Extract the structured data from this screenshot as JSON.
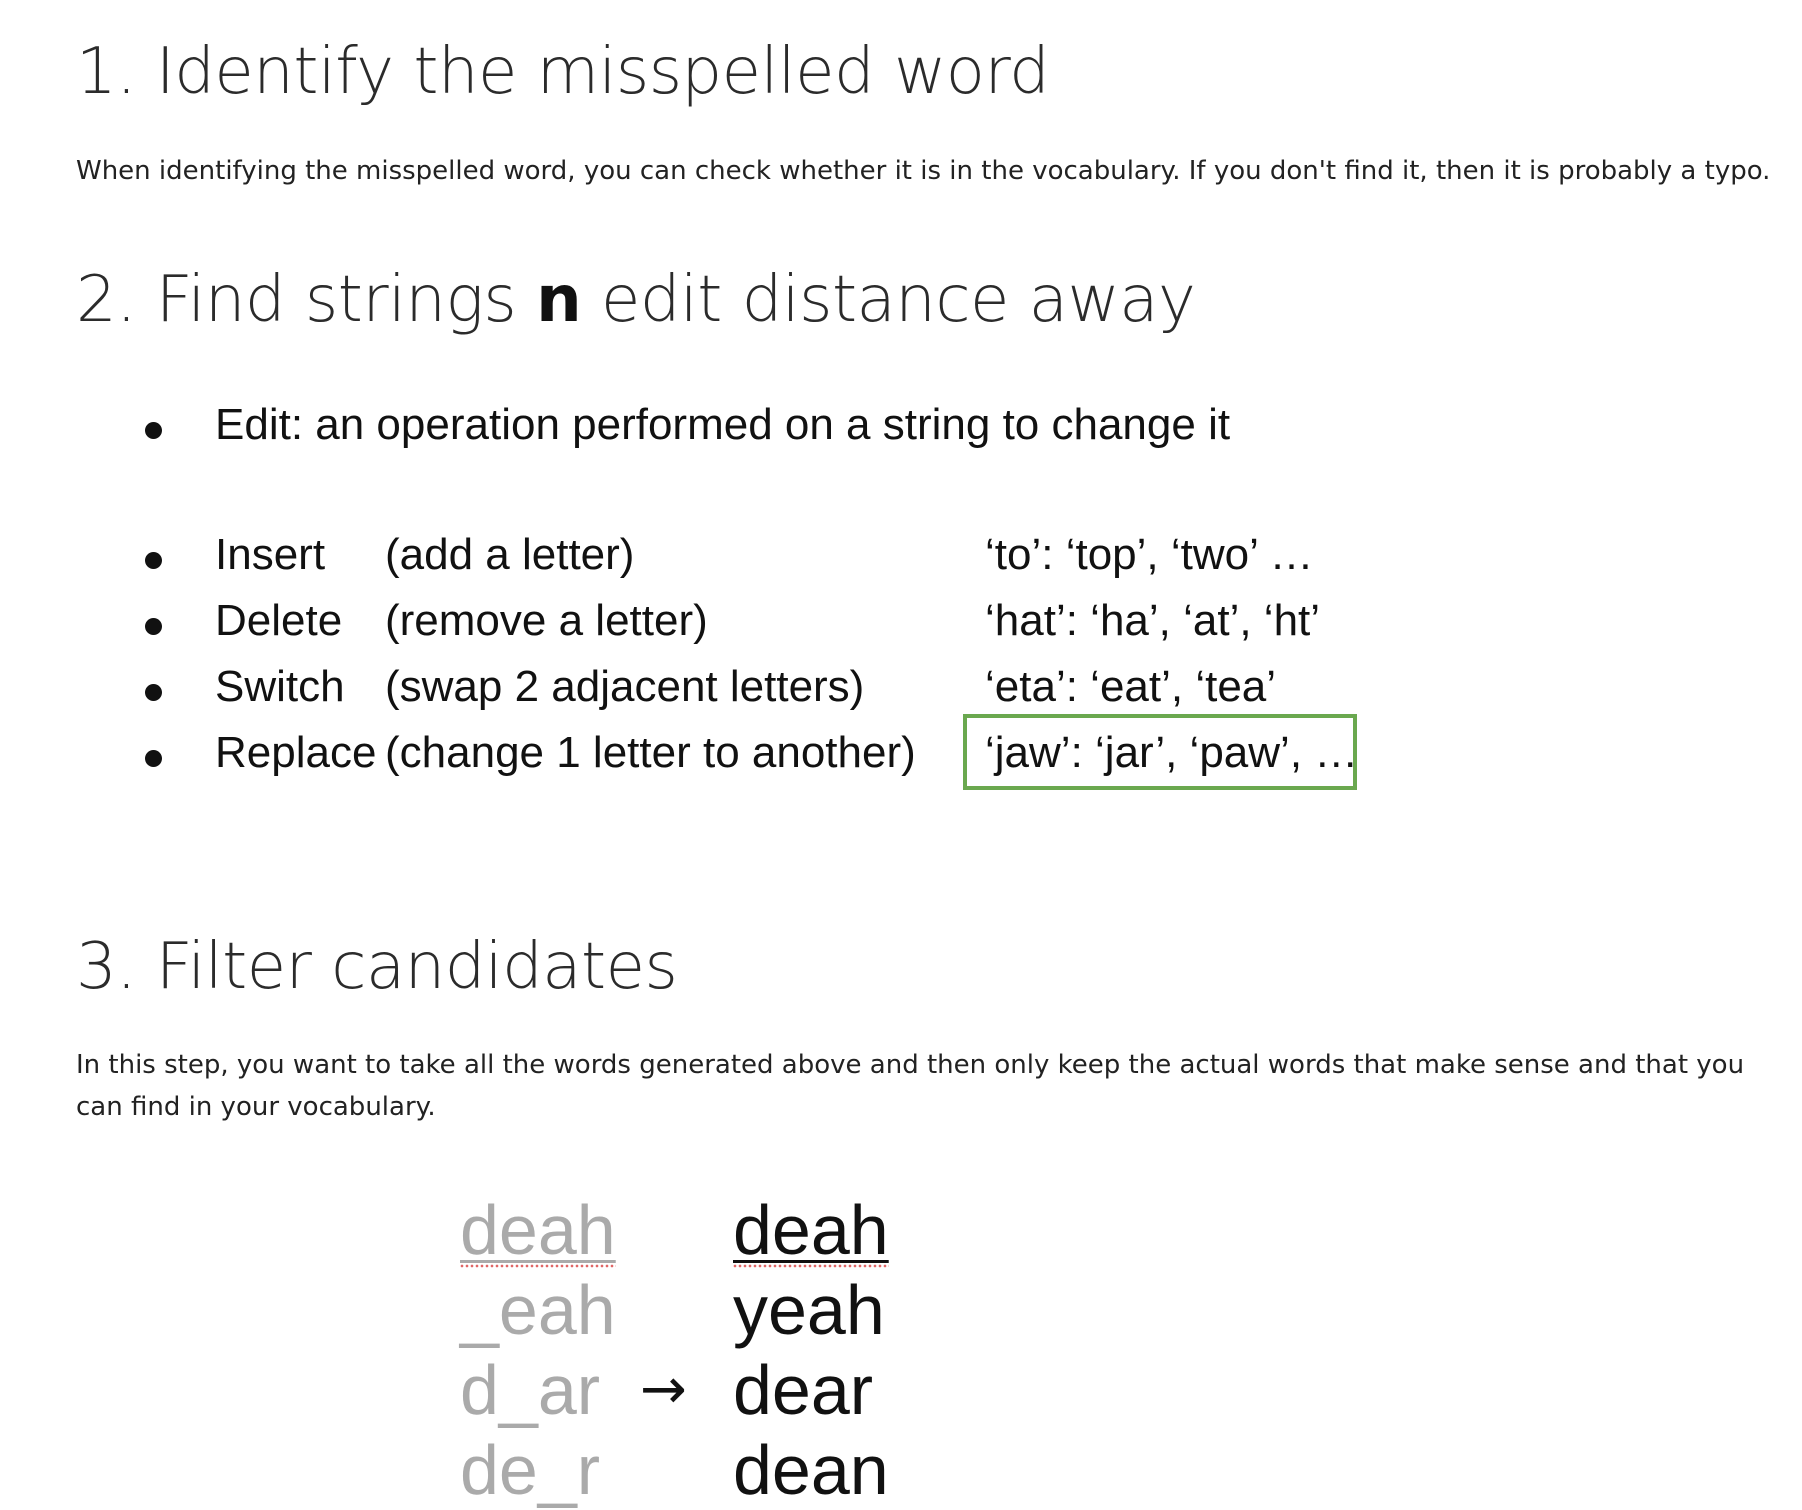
{
  "section1": {
    "heading": "1. Identify the misspelled word",
    "paragraph": "When identifying the misspelled word, you can check whether it is in the vocabulary. If you don't find it, then it is probably a typo."
  },
  "section2": {
    "heading_prefix": "2. Find strings ",
    "heading_bold": "n",
    "heading_suffix": " edit distance away",
    "edit_definition": "Edit: an operation performed on a string to change it",
    "operations": [
      {
        "name": "Insert",
        "description": "(add a letter)",
        "example": "‘to’:  ‘top’, ‘two’ …"
      },
      {
        "name": "Delete",
        "description": "(remove a letter)",
        "example": "‘hat’: ‘ha’, ‘at’, ‘ht’"
      },
      {
        "name": "Switch",
        "description": "(swap 2 adjacent letters)",
        "example": "‘eta’:  ‘eat’, ‘tea’"
      },
      {
        "name": "Replace",
        "description": "(change 1 letter to another)",
        "example": "‘jaw’: ‘jar’, ‘paw’, …"
      }
    ],
    "highlight_color": "#6aa84f"
  },
  "section3": {
    "heading": "3. Filter candidates",
    "paragraph": "In this step, you want to take all the words generated above and then only keep the actual words that make sense and that you can find in your vocabulary.",
    "candidates_left": [
      "deah",
      "_eah",
      "d_ar",
      "de_r"
    ],
    "candidates_right": [
      "deah",
      "yeah",
      "dear",
      "dean"
    ],
    "arrow": "→"
  }
}
